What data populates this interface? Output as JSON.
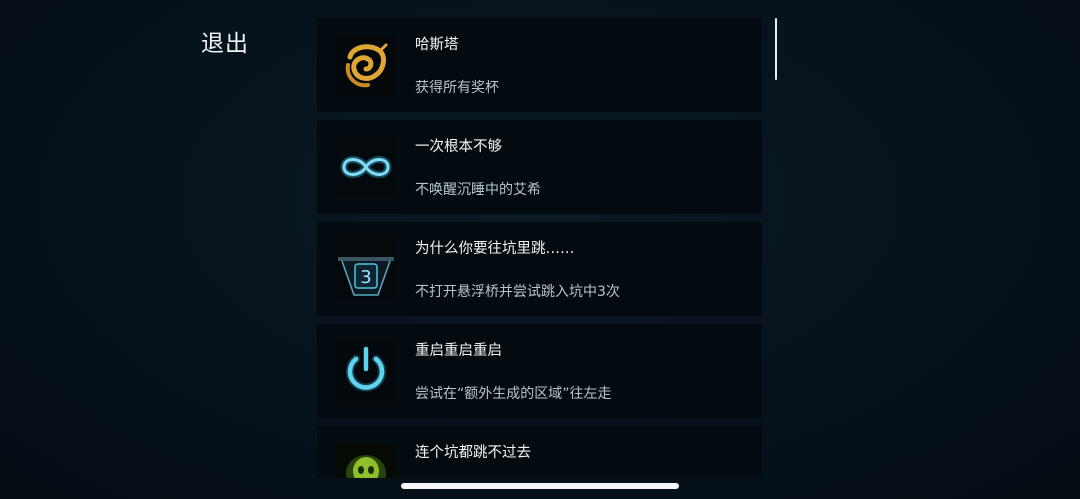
{
  "exit_label": "退出",
  "achievements": [
    {
      "title": "哈斯塔",
      "description": "获得所有奖杯",
      "icon": "golden-spiral-sigil-icon"
    },
    {
      "title": "一次根本不够",
      "description": "不唤醒沉睡中的艾希",
      "icon": "infinity-icon"
    },
    {
      "title": "为什么你要往坑里跳……",
      "description": "不打开悬浮桥并尝试跳入坑中3次",
      "icon": "pit-number-3-icon",
      "icon_number": "3"
    },
    {
      "title": "重启重启重启",
      "description": "尝试在“额外生成的区域”往左走",
      "icon": "power-icon"
    },
    {
      "title": "连个坑都跳不过去",
      "description": "",
      "icon": "green-skull-icon"
    }
  ],
  "colors": {
    "background": "#06121b",
    "card": "#030a10",
    "gold": "#e0a634",
    "cyan": "#4fc6e3",
    "green": "#8fbf2a"
  }
}
